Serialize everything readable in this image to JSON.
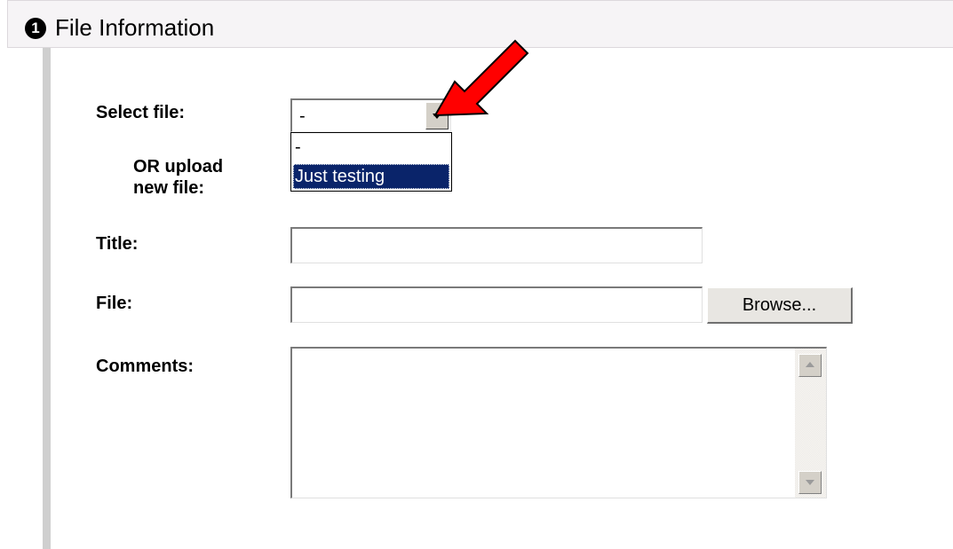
{
  "section": {
    "step_number": "1",
    "title": "File Information"
  },
  "form": {
    "select_file_label": "Select file:",
    "or_upload_line1": "OR upload",
    "or_upload_line2": "new file:",
    "title_label": "Title:",
    "file_label": "File:",
    "comments_label": "Comments:",
    "select_value": "-",
    "dropdown_options": [
      "-",
      "Just testing"
    ],
    "highlighted_option": "Just testing",
    "title_value": "",
    "file_value": "",
    "browse_button_label": "Browse...",
    "comments_value": ""
  },
  "annotation": {
    "arrow_color": "#ff0000",
    "arrow_icon": "red-arrow-icon"
  },
  "colors": {
    "header_background": "#f6f4f6",
    "left_rule": "#cfcfcf",
    "selected_option_background": "#0a246a",
    "selected_option_text": "#ffffff"
  }
}
